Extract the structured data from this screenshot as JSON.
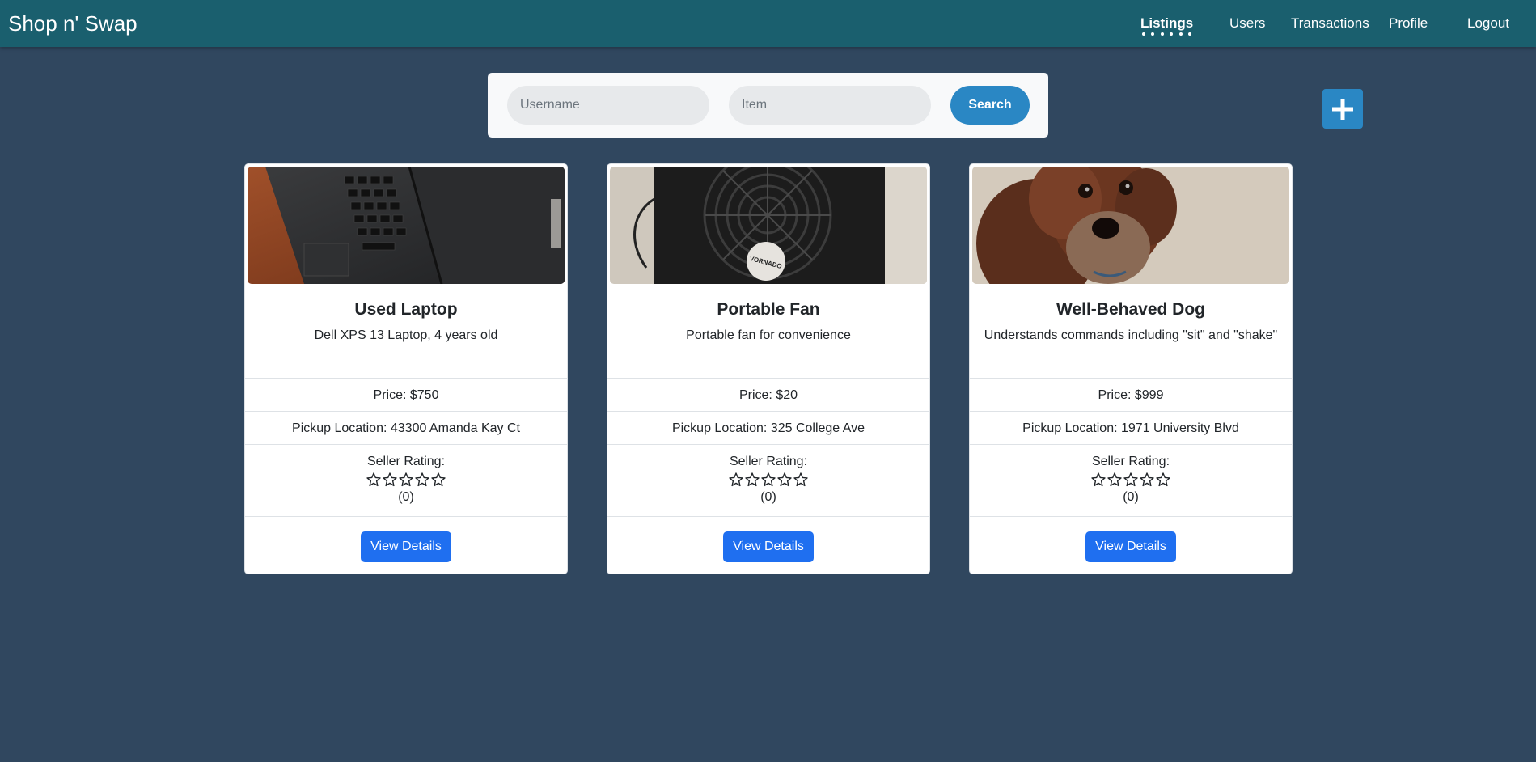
{
  "app": {
    "title": "Shop n' Swap"
  },
  "nav": {
    "listings": "Listings",
    "users": "Users",
    "transactions": "Transactions",
    "profile": "Profile",
    "logout": "Logout"
  },
  "search": {
    "username_placeholder": "Username",
    "username_value": "",
    "item_placeholder": "Item",
    "item_value": "",
    "button_label": "Search"
  },
  "add_button": {
    "icon": "plus-icon"
  },
  "listings": [
    {
      "title": "Used Laptop",
      "description": "Dell XPS 13 Laptop, 4 years old",
      "price": "Price: $750",
      "pickup": "Pickup Location: 43300 Amanda Kay Ct",
      "rating_label": "Seller Rating:",
      "rating_count": "(0)",
      "stars_filled": 0,
      "button_label": "View Details",
      "image": "laptop-photo"
    },
    {
      "title": "Portable Fan",
      "description": "Portable fan for convenience",
      "price": "Price: $20",
      "pickup": "Pickup Location: 325 College Ave",
      "rating_label": "Seller Rating:",
      "rating_count": "(0)",
      "stars_filled": 0,
      "button_label": "View Details",
      "image": "fan-photo",
      "image_brand_text": "VORNADO"
    },
    {
      "title": "Well-Behaved Dog",
      "description": "Understands commands including \"sit\" and \"shake\"",
      "price": "Price: $999",
      "pickup": "Pickup Location: 1971 University Blvd",
      "rating_label": "Seller Rating:",
      "rating_count": "(0)",
      "stars_filled": 0,
      "button_label": "View Details",
      "image": "dog-photo"
    }
  ],
  "colors": {
    "background": "#30475f",
    "topbar": "#1a5f6e",
    "accent": "#2a87c4",
    "primary_button": "#1f6ff0"
  }
}
